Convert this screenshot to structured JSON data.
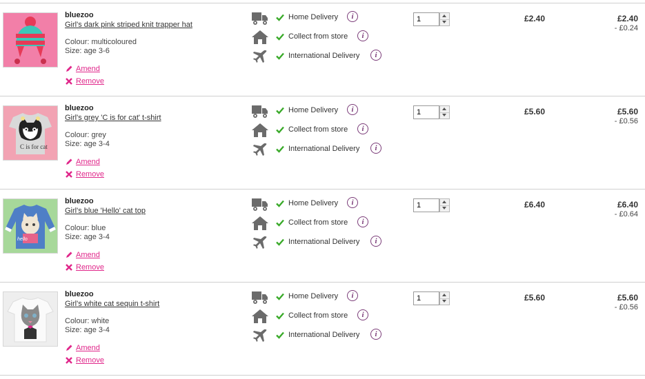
{
  "actions": {
    "amend_label": "Amend",
    "remove_label": "Remove"
  },
  "delivery_options": [
    {
      "label": "Home Delivery",
      "icon": "delivery-van-icon",
      "status": "check-icon"
    },
    {
      "label": "Collect from store",
      "icon": "store-house-icon",
      "status": "check-icon"
    },
    {
      "label": "International Delivery",
      "icon": "airplane-icon",
      "status": "check-icon"
    }
  ],
  "colors": {
    "accent": "#e0268a",
    "tick": "#3aaa2a",
    "info": "#7a3b78",
    "icon_grey": "#6b6b6b",
    "divider": "#cfcfcf"
  },
  "items": [
    {
      "brand": "bluezoo",
      "name": "Girl's dark pink striped knit trapper hat",
      "colour": "Colour: multicoloured",
      "size": "Size: age 3-6",
      "quantity": "1",
      "unit_price": "£2.40",
      "total_price": "£2.40",
      "discount": "- £0.24",
      "image": "knit-hat-image"
    },
    {
      "brand": "bluezoo",
      "name": "Girl's grey 'C is for cat' t-shirt",
      "colour": "Colour: grey",
      "size": "Size: age 3-4",
      "quantity": "1",
      "unit_price": "£5.60",
      "total_price": "£5.60",
      "discount": "- £0.56",
      "image": "cat-tshirt-image"
    },
    {
      "brand": "bluezoo",
      "name": "Girl's blue 'Hello' cat top",
      "colour": "Colour: blue",
      "size": "Size: age 3-4",
      "quantity": "1",
      "unit_price": "£6.40",
      "total_price": "£6.40",
      "discount": "- £0.64",
      "image": "hello-cat-top-image"
    },
    {
      "brand": "bluezoo",
      "name": "Girl's white cat sequin t-shirt",
      "colour": "Colour: white",
      "size": "Size: age 3-4",
      "quantity": "1",
      "unit_price": "£5.60",
      "total_price": "£5.60",
      "discount": "- £0.56",
      "image": "sequin-cat-tshirt-image"
    }
  ]
}
